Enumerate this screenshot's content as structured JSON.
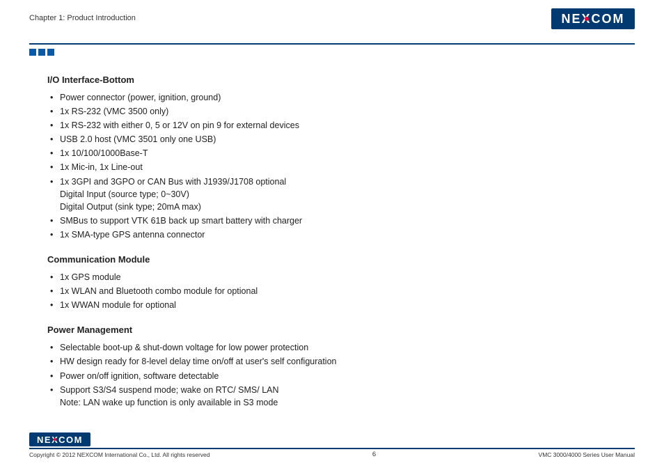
{
  "header": {
    "chapter": "Chapter 1: Product Introduction",
    "brand_left": "NE",
    "brand_x": "X",
    "brand_right": "COM"
  },
  "sections": {
    "io": {
      "heading": "I/O Interface-Bottom",
      "items": [
        {
          "text": "Power connector (power, ignition, ground)"
        },
        {
          "text": "1x RS-232 (VMC 3500 only)"
        },
        {
          "text": "1x RS-232 with either 0, 5 or 12V on pin 9 for external devices"
        },
        {
          "text": "USB 2.0 host (VMC 3501 only one USB)"
        },
        {
          "text": "1x 10/100/1000Base-T"
        },
        {
          "text": "1x Mic-in, 1x Line-out"
        },
        {
          "text": "1x 3GPI and 3GPO or CAN Bus with J1939/J1708 optional",
          "sub1": "Digital Input (source type; 0~30V)",
          "sub2": "Digital Output (sink type; 20mA max)"
        },
        {
          "text": "SMBus to support VTK 61B back up smart battery with charger"
        },
        {
          "text": "1x SMA-type GPS antenna connector"
        }
      ]
    },
    "comm": {
      "heading": "Communication Module",
      "items": [
        {
          "text": "1x GPS module"
        },
        {
          "text": "1x WLAN and Bluetooth combo module for optional"
        },
        {
          "text": "1x WWAN module for optional"
        }
      ]
    },
    "power": {
      "heading": "Power Management",
      "items": [
        {
          "text": "Selectable boot-up & shut-down voltage for low power protection"
        },
        {
          "text": "HW design ready for 8-level delay time on/off at user's self configuration"
        },
        {
          "text": "Power on/off ignition, software detectable"
        },
        {
          "text": "Support S3/S4 suspend mode; wake on RTC/ SMS/ LAN",
          "sub1": "Note: LAN wake up function is only available in S3 mode"
        }
      ]
    }
  },
  "footer": {
    "copyright": "Copyright © 2012 NEXCOM International Co., Ltd. All rights reserved",
    "page": "6",
    "manual": "VMC 3000/4000 Series User Manual"
  }
}
